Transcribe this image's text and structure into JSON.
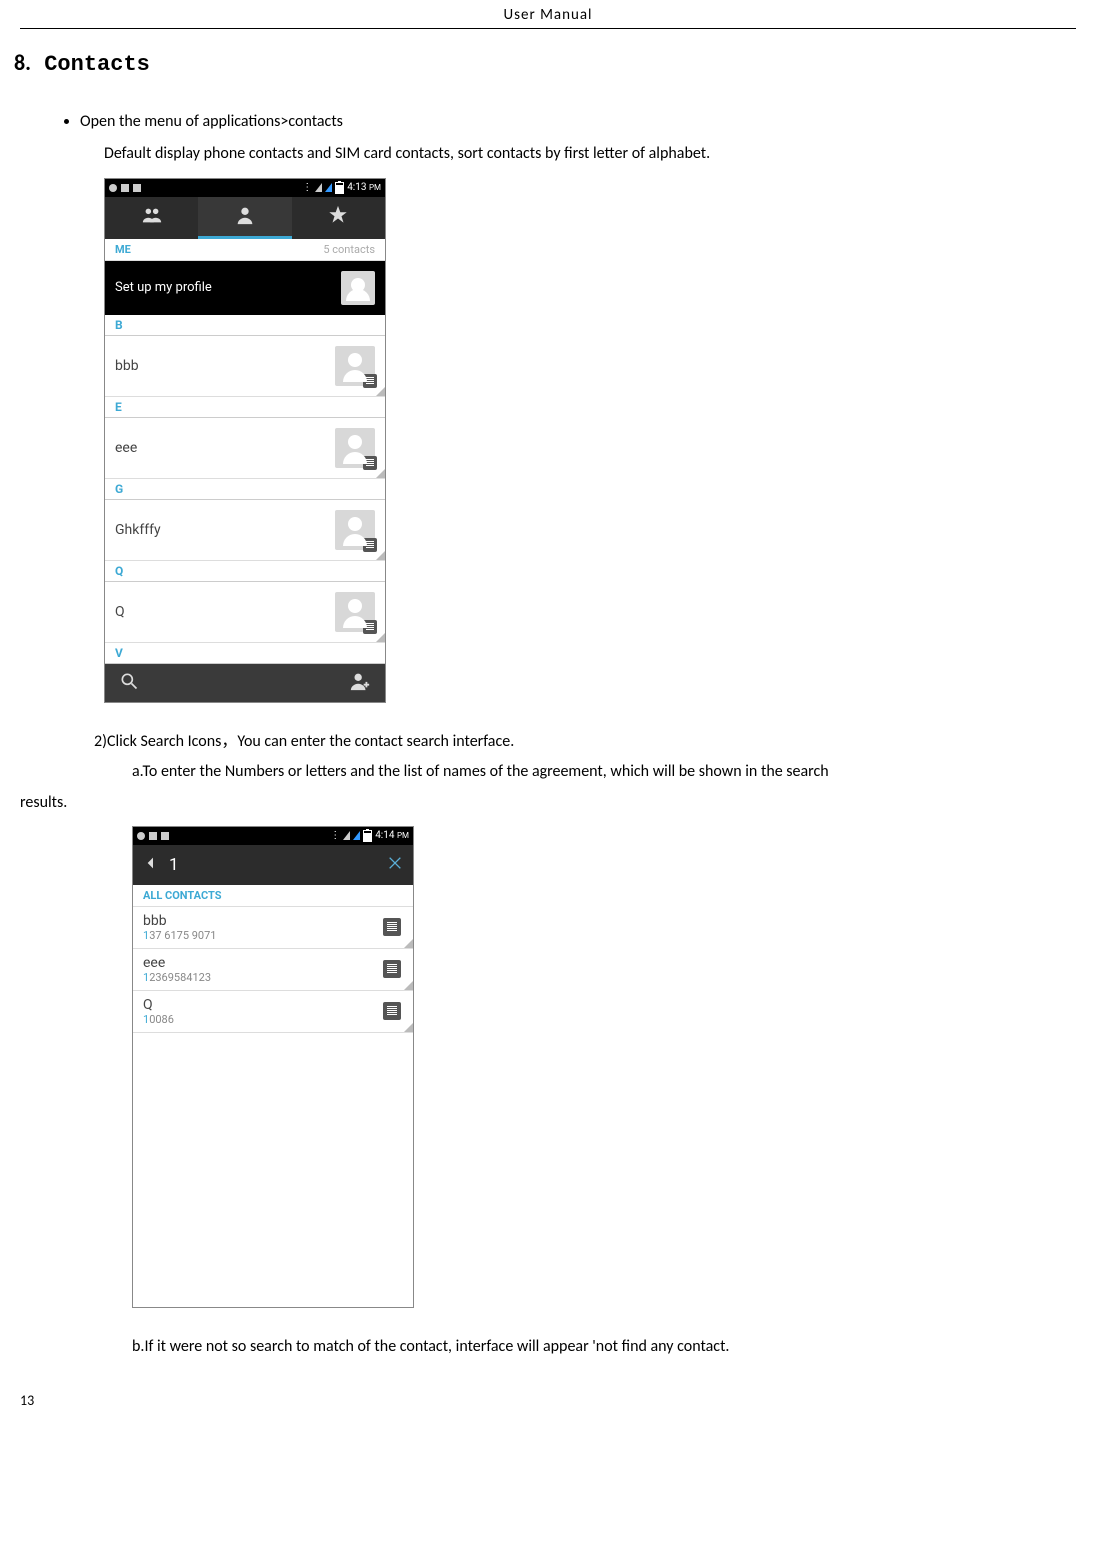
{
  "header": "User    Manual",
  "section": {
    "number": "8.",
    "title": "Contacts"
  },
  "bullet1": {
    "line1": "Open the menu of applications>contacts",
    "line2": "Default display phone contacts and SIM card contacts, sort contacts by first letter of alphabet."
  },
  "phone1": {
    "status_time": "4:13",
    "status_ampm": "PM",
    "me_label": "ME",
    "count_label": "5 contacts",
    "profile_label": "Set up my profile",
    "sections": [
      {
        "letter": "B",
        "name": "bbb"
      },
      {
        "letter": "E",
        "name": "eee"
      },
      {
        "letter": "G",
        "name": "Ghkfffy"
      },
      {
        "letter": "Q",
        "name": "Q"
      },
      {
        "letter": "V",
        "name": ""
      }
    ]
  },
  "para2": {
    "line1": "2)Click Search Icons，You can enter the contact search interface.",
    "line2a": "a.To enter the Numbers or letters and the list of names of the agreement, which will be shown in the search",
    "line2b": "results."
  },
  "phone2": {
    "status_time": "4:14",
    "status_ampm": "PM",
    "query": "1",
    "all_label": "ALL CONTACTS",
    "results": [
      {
        "name": "bbb",
        "hl": "1",
        "rest": "37 6175 9071"
      },
      {
        "name": "eee",
        "hl": "1",
        "rest": "2369584123"
      },
      {
        "name": "Q",
        "hl": "1",
        "rest": "0086"
      }
    ]
  },
  "para3": "b.If it were not so search to match of the contact, interface will appear 'not find any contact.",
  "page_number": "13"
}
